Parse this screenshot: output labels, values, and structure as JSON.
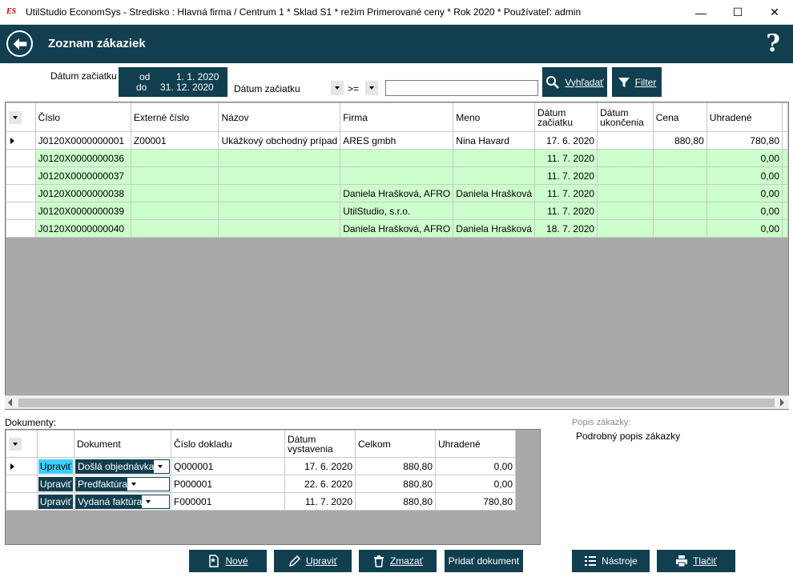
{
  "window": {
    "logo_text": "ES",
    "title": "UtilStudio EconomSys - Stredisko : Hlavná firma /  Centrum 1 * Sklad S1 * režim Primerované ceny * Rok 2020 * Používateľ: admin",
    "minimize": "—",
    "maximize": "☐",
    "close": "✕"
  },
  "header": {
    "title": "Zoznam zákaziek",
    "help": "?"
  },
  "filter": {
    "date_label": "Dátum začiatku",
    "from_label": "od",
    "from_value": "1. 1. 2020",
    "to_label": "do",
    "to_value": "31. 12. 2020",
    "field_select": "Dátum začiatku",
    "operator": ">=",
    "search_value": "",
    "search_button": "Vyhľadať",
    "filter_button": "Filter"
  },
  "grid": {
    "columns": [
      "Číslo",
      "Externé číslo",
      "Názov",
      "Firma",
      "Meno",
      "Dátum\nzačiatku",
      "Dátum\nukončenia",
      "Cena",
      "Uhradené"
    ],
    "rows": [
      [
        "J0120X0000000001",
        "Z00001",
        "Ukážkový obchodný prípad",
        "ARES gmbh",
        "Nina Havard",
        "17. 6. 2020",
        "",
        "880,80",
        "780,80"
      ],
      [
        "J0120X0000000036",
        "",
        "",
        "",
        "",
        "11. 7. 2020",
        "",
        "",
        "0,00"
      ],
      [
        "J0120X0000000037",
        "",
        "",
        "",
        "",
        "11. 7. 2020",
        "",
        "",
        "0,00"
      ],
      [
        "J0120X0000000038",
        "",
        "",
        "Daniela Hrašková, AFRO",
        "Daniela Hrašková",
        "11. 7. 2020",
        "",
        "",
        "0,00"
      ],
      [
        "J0120X0000000039",
        "",
        "",
        "UtilStudio, s.r.o.",
        "",
        "11. 7. 2020",
        "",
        "",
        "0,00"
      ],
      [
        "J0120X0000000040",
        "",
        "",
        "Daniela Hrašková, AFRO",
        "Daniela Hrašková",
        "18. 7. 2020",
        "",
        "",
        "0,00"
      ]
    ],
    "colors": {
      "highlight": "#ccffcc",
      "background": "#a9a9a9"
    }
  },
  "documents": {
    "label": "Dokumenty:",
    "columns": [
      "",
      "Dokument",
      "Číslo dokladu",
      "Dátum\nvystavenia",
      "Celkom",
      "Uhradené"
    ],
    "rows": [
      {
        "edit": "Upraviť",
        "doc": "Došlá objednávka",
        "number": "Q000001",
        "date": "17. 6. 2020",
        "total": "880,80",
        "paid": "0,00"
      },
      {
        "edit": "Upraviť",
        "doc": "Predfaktúra",
        "number": "P000001",
        "date": "22. 6. 2020",
        "total": "880,80",
        "paid": "0,00"
      },
      {
        "edit": "Upraviť",
        "doc": "Vydaná faktúra",
        "number": "F000001",
        "date": "11. 7. 2020",
        "total": "880,80",
        "paid": "780,80"
      }
    ]
  },
  "description": {
    "label": "Popis zákazky:",
    "value": "Podrobný popis zákazky"
  },
  "actions": {
    "new": "Nové",
    "edit": "Upraviť",
    "delete": "Zmazať",
    "add_document": "Pridať dokument",
    "tools": "Nástroje",
    "print": "Tlačiť"
  },
  "theme": {
    "primary": "#113f4f",
    "active_edit": "#3ccfff"
  }
}
